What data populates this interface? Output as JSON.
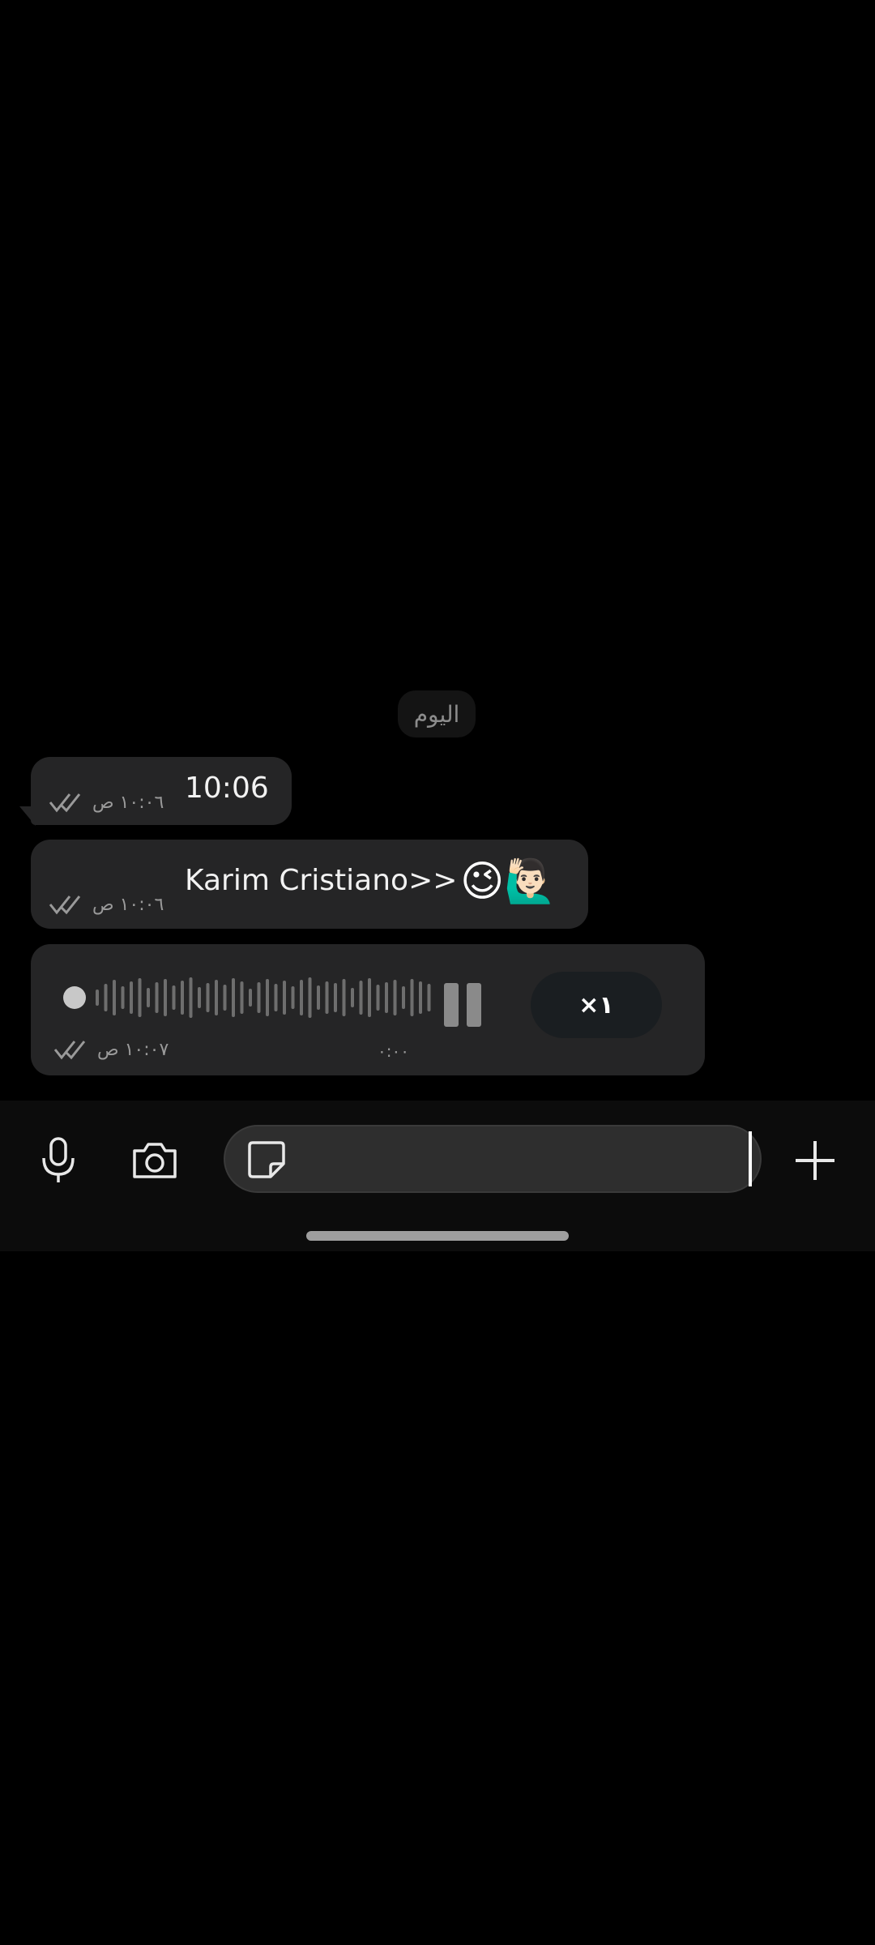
{
  "date_divider": "اليوم",
  "messages": [
    {
      "type": "text",
      "text": "10:06",
      "time": "١٠:٠٦ ص"
    },
    {
      "type": "text",
      "text": "Karim Cristiano>>",
      "emojis": "😉🙋🏻‍♂️",
      "time": "١٠:٠٦ ص"
    },
    {
      "type": "voice",
      "playback_state": "playing",
      "duration": "٠:٠٠",
      "speed_label": "×١",
      "time": "١٠:٠٧ ص"
    }
  ],
  "composer": {
    "placeholder": "",
    "icons": [
      "mic-icon",
      "camera-icon",
      "sticker-icon",
      "plus-icon"
    ]
  },
  "colors": {
    "background": "#000000",
    "bubble": "#252526",
    "composer_bar": "#0c0c0c",
    "meta_text": "#9a9a9a"
  }
}
